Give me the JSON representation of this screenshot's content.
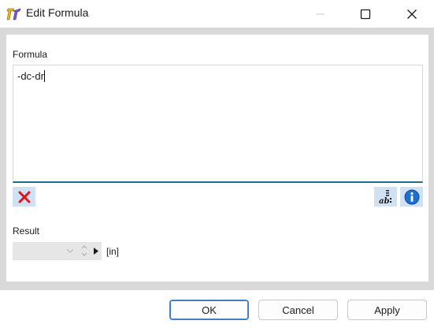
{
  "window": {
    "title": "Edit Formula",
    "app_icon": "formula-app-icon"
  },
  "titlebar_controls": {
    "minimize_icon": "minimize-icon",
    "maximize_icon": "maximize-icon",
    "close_icon": "close-icon"
  },
  "formula": {
    "label": "Formula",
    "value": "-dc-dr"
  },
  "tools": {
    "clear_icon": "red-x-icon",
    "ab_icon": "text-format-icon",
    "info_icon": "info-icon"
  },
  "result": {
    "label": "Result",
    "value": "",
    "unit": "[in]"
  },
  "buttons": {
    "ok": "OK",
    "cancel": "Cancel",
    "apply": "Apply"
  },
  "colors": {
    "frame": "#d9d9d9",
    "accent": "#1f6f8b",
    "tool_bg": "#cfe1f2",
    "clear_red": "#e0141e",
    "info_blue": "#1d6fd1"
  }
}
